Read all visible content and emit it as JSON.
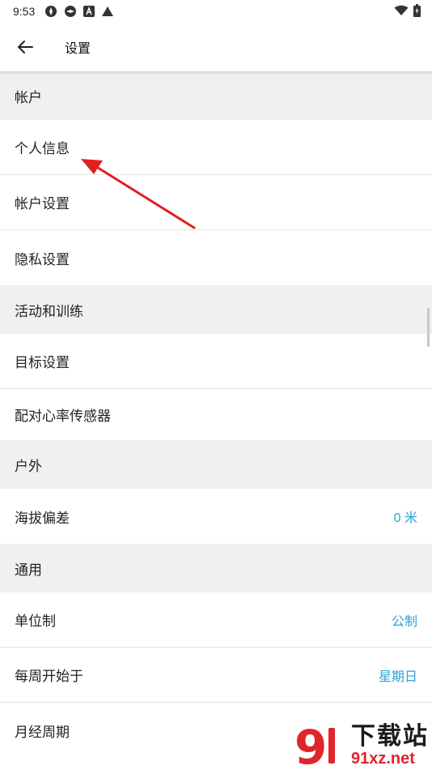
{
  "statusbar": {
    "time": "9:53",
    "left_icons": [
      "notification-icon",
      "notification-icon",
      "a-icon",
      "triangle-icon"
    ],
    "right_icons": [
      "wifi-icon",
      "battery-icon"
    ]
  },
  "appbar": {
    "title": "设置",
    "back_icon": "back-arrow-icon"
  },
  "sections": {
    "account": {
      "header": "帐户",
      "items": [
        {
          "label": "个人信息"
        },
        {
          "label": "帐户设置"
        },
        {
          "label": "隐私设置"
        }
      ]
    },
    "activity": {
      "header": "活动和训练",
      "items": [
        {
          "label": "目标设置"
        },
        {
          "label": "配对心率传感器"
        }
      ]
    },
    "outdoor": {
      "header": "户外",
      "items": [
        {
          "label": "海拔偏差",
          "value": "0 米"
        }
      ]
    },
    "general": {
      "header": "通用",
      "items": [
        {
          "label": "单位制",
          "value": "公制"
        },
        {
          "label": "每周开始于",
          "value": "星期日"
        },
        {
          "label": "月经周期"
        }
      ]
    }
  },
  "colors": {
    "value_text": "#2aa3d8",
    "section_bg": "#f0f0f0",
    "annotation_arrow": "#e02020"
  },
  "watermark": {
    "logo_glyph": "9",
    "text": "下载站",
    "url": "91xz.net"
  }
}
